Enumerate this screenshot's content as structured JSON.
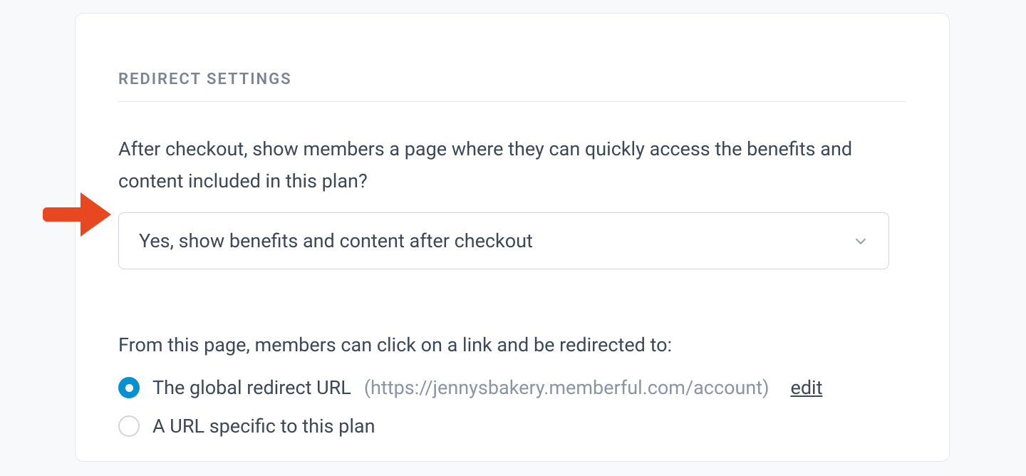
{
  "section": {
    "title": "REDIRECT SETTINGS",
    "question": "After checkout, show members a page where they can quickly access the benefits and content included in this plan?",
    "select": {
      "value": "Yes, show benefits and content after checkout"
    },
    "redirect_label": "From this page, members can click on a link and be redirected to:",
    "radios": {
      "global": {
        "label": "The global redirect URL",
        "url": "(https://jennysbakery.memberful.com/account)",
        "edit": "edit",
        "checked": true
      },
      "specific": {
        "label": "A URL specific to this plan",
        "checked": false
      }
    }
  },
  "annotation": {
    "arrow_color": "#e8481f"
  }
}
